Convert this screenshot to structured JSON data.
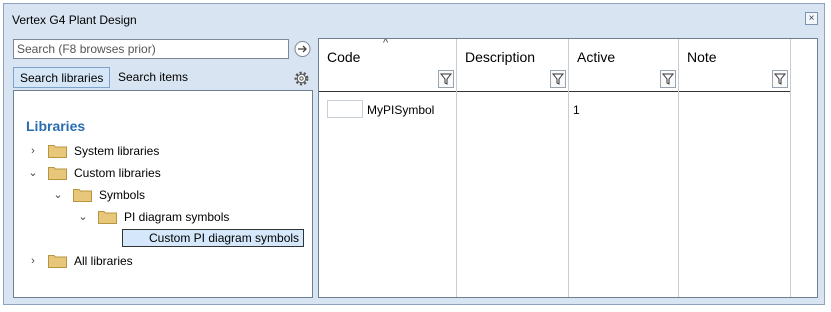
{
  "window": {
    "title": "Vertex G4 Plant Design",
    "close_label": "×"
  },
  "search": {
    "placeholder": "Search (F8 browses prior)"
  },
  "tabs": [
    {
      "label": "Search libraries",
      "active": true
    },
    {
      "label": "Search items",
      "active": false
    }
  ],
  "tree": {
    "heading": "Libraries",
    "items": [
      {
        "label": "System libraries",
        "expanded": false
      },
      {
        "label": "Custom libraries",
        "expanded": true
      },
      {
        "label": "Symbols",
        "expanded": true
      },
      {
        "label": "PI diagram symbols",
        "expanded": true
      },
      {
        "label": "Custom PI diagram symbols",
        "selected": true
      },
      {
        "label": "All libraries",
        "expanded": false
      }
    ]
  },
  "grid": {
    "columns": [
      "Code",
      "Description",
      "Active",
      "Note"
    ],
    "sorted_column": "Code",
    "rows": [
      {
        "code": "MyPISymbol",
        "description": "",
        "active": "1",
        "note": ""
      }
    ]
  },
  "colors": {
    "window_bg": "#d9e4f2",
    "heading": "#2b6cb0",
    "folder": "#e8c77a",
    "selection": "#d5e8fb"
  }
}
